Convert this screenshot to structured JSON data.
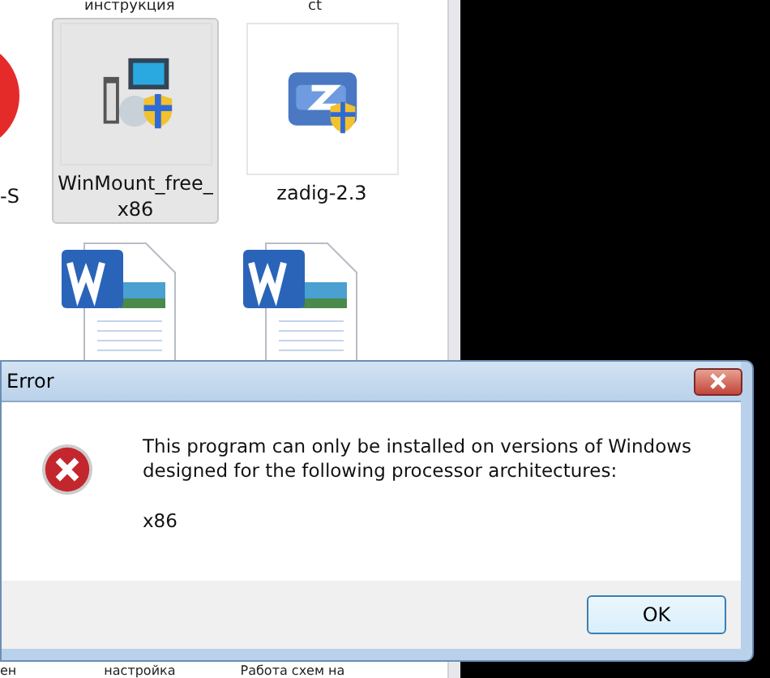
{
  "explorer": {
    "top_labels": [
      "инструкция",
      "ct"
    ],
    "items": [
      {
        "kind": "partial",
        "label": "-S"
      },
      {
        "kind": "installer",
        "label": "WinMount_free_x86",
        "selected": true
      },
      {
        "kind": "zadig",
        "label": "zadig-2.3",
        "selected": false
      },
      {
        "kind": "word"
      },
      {
        "kind": "word"
      }
    ],
    "bottom_labels": [
      "ен",
      "настройка",
      "Работа схем на"
    ]
  },
  "dialog": {
    "title": "Error",
    "message": "This program can only be installed on versions of Windows designed for the following processor architectures:",
    "detail": "x86",
    "buttons": [
      "OK"
    ]
  }
}
